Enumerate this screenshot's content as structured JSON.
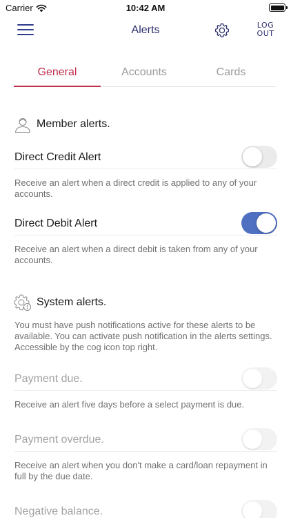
{
  "status_bar": {
    "carrier": "Carrier",
    "time": "10:42 AM"
  },
  "nav": {
    "title": "Alerts",
    "logout_line1": "LOG",
    "logout_line2": "OUT"
  },
  "tabs": [
    {
      "label": "General"
    },
    {
      "label": "Accounts"
    },
    {
      "label": "Cards"
    }
  ],
  "member_section": {
    "title": "Member alerts."
  },
  "member_alerts": [
    {
      "title": "Direct Credit Alert",
      "enabled": false,
      "description": "Receive an alert when a direct credit is applied to any of your accounts."
    },
    {
      "title": "Direct Debit Alert",
      "enabled": true,
      "description": "Receive an alert when a direct debit is taken from any of your accounts."
    }
  ],
  "system_section": {
    "title": "System alerts.",
    "note": "You must have push notifications active for these alerts to be available. You can activate push notification in the alerts settings. Accessible by the cog icon top right."
  },
  "system_alerts": [
    {
      "title": "Payment due.",
      "enabled": false,
      "description": "Receive an alert five days before a select payment is due."
    },
    {
      "title": "Payment overdue.",
      "enabled": false,
      "description": "Receive an alert when you don't make a card/loan repayment in full by the due date."
    },
    {
      "title": "Negative balance.",
      "enabled": false
    }
  ],
  "colors": {
    "accent": "#c0304e",
    "nav": "#2b2f6b",
    "toggle_on": "#4f6fc0"
  }
}
